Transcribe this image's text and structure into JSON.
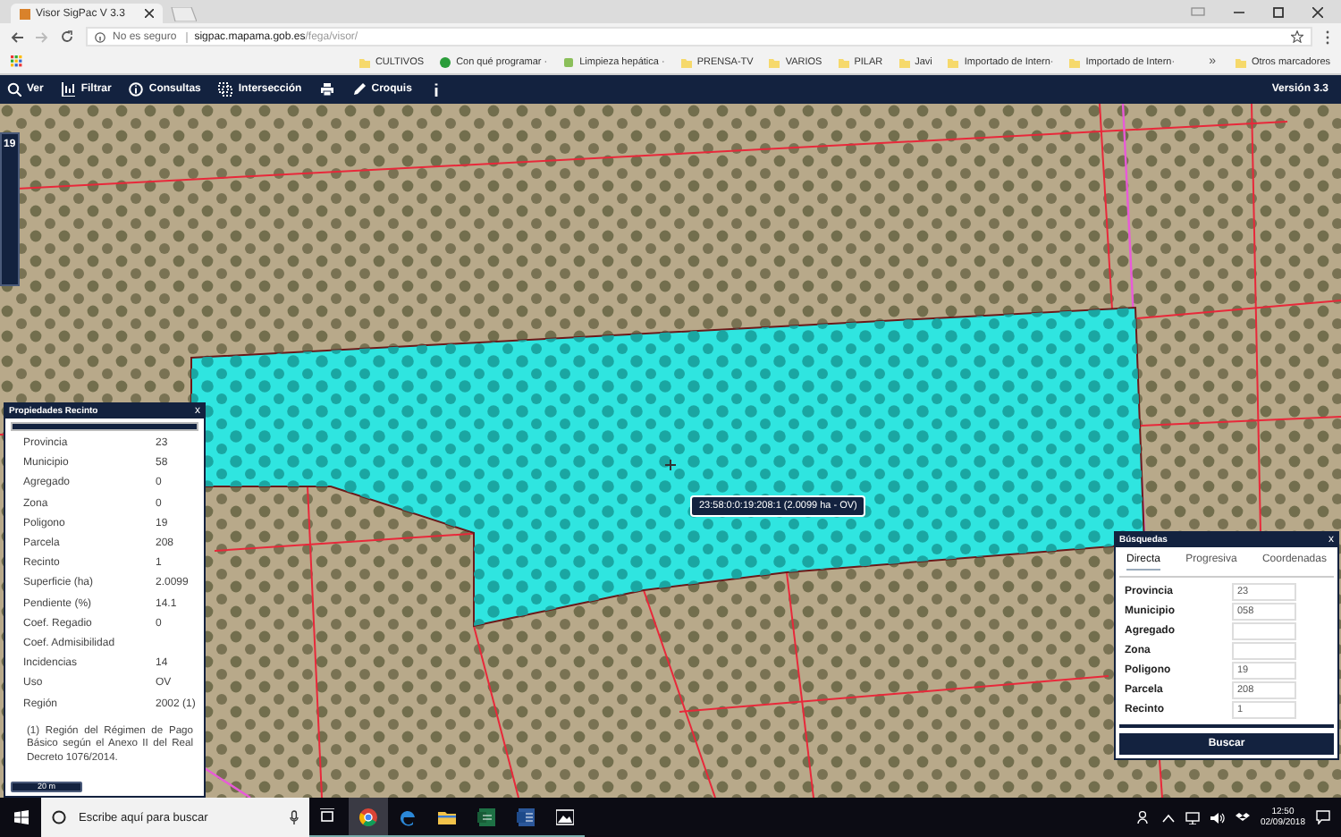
{
  "browser": {
    "tab_title": "Visor SigPac V 3.3",
    "security": "No es seguro",
    "url_host": "sigpac.mapama.gob.es",
    "url_path": "/fega/visor/",
    "bookmarks": [
      {
        "label": "CULTIVOS"
      },
      {
        "label": "Con qué programar ·"
      },
      {
        "label": "Limpieza hepática ·"
      },
      {
        "label": "PRENSA-TV"
      },
      {
        "label": "VARIOS"
      },
      {
        "label": "PILAR"
      },
      {
        "label": "Javi"
      },
      {
        "label": "Importado de Intern·"
      },
      {
        "label": "Importado de Intern·"
      }
    ],
    "more": "»",
    "other_bookmarks": "Otros marcadores"
  },
  "toolbar": {
    "items": [
      {
        "kind": "search",
        "label": "Ver"
      },
      {
        "kind": "filter",
        "label": "Filtrar"
      },
      {
        "kind": "query",
        "label": "Consultas"
      },
      {
        "kind": "intersection",
        "label": "Intersección"
      },
      {
        "kind": "print"
      },
      {
        "kind": "sketch",
        "label": "Croquis"
      },
      {
        "kind": "info"
      }
    ],
    "version": "Versión 3.3"
  },
  "map": {
    "zoom_level": "19",
    "parcel_label": "23:58:0:0:19:208:1 (2.0099 ha - OV)"
  },
  "properties_panel": {
    "title": "Propiedades Recinto",
    "close": "x",
    "rows": [
      {
        "label": "Provincia",
        "value": "23"
      },
      {
        "label": "Municipio",
        "value": "58"
      },
      {
        "label": "Agregado",
        "value": "0"
      },
      {
        "label": "Zona",
        "value": "0"
      },
      {
        "label": "Poligono",
        "value": "19"
      },
      {
        "label": "Parcela",
        "value": "208"
      },
      {
        "label": "Recinto",
        "value": "1"
      },
      {
        "label": "Superficie (ha)",
        "value": "2.0099"
      },
      {
        "label": "Pendiente (%)",
        "value": "14.1"
      },
      {
        "label": "Coef. Regadio",
        "value": "0"
      },
      {
        "label": "Coef. Admisibilidad"
      },
      {
        "label": "Incidencias",
        "value": "14"
      },
      {
        "label": "Uso",
        "value": "OV"
      },
      {
        "label": "Región",
        "value": "2002 (1)"
      }
    ],
    "note": "(1) Región del Régimen de Pago Básico según el Anexo II del Real Decreto 1076/2014.",
    "scale": "20 m"
  },
  "search_panel": {
    "title": "Búsquedas",
    "close": "x",
    "tabs": [
      {
        "label": "Directa",
        "selected": true
      },
      {
        "label": "Progresiva",
        "selected": false
      },
      {
        "label": "Coordenadas",
        "selected": false
      }
    ],
    "fields": [
      {
        "label": "Provincia",
        "value": "23"
      },
      {
        "label": "Municipio",
        "value": "058"
      },
      {
        "label": "Agregado"
      },
      {
        "label": "Zona"
      },
      {
        "label": "Poligono",
        "value": "19"
      },
      {
        "label": "Parcela",
        "value": "208"
      },
      {
        "label": "Recinto",
        "value": "1"
      }
    ],
    "button": "Buscar"
  },
  "taskbar": {
    "search_placeholder": "Escribe aquí para buscar",
    "apps": [
      {
        "selected": false
      },
      {
        "selected": true
      },
      {
        "selected": false
      },
      {
        "selected": false
      },
      {
        "selected": false
      },
      {
        "selected": false
      },
      {
        "selected": false
      }
    ],
    "time": "12:50",
    "date": "02/09/2018"
  }
}
